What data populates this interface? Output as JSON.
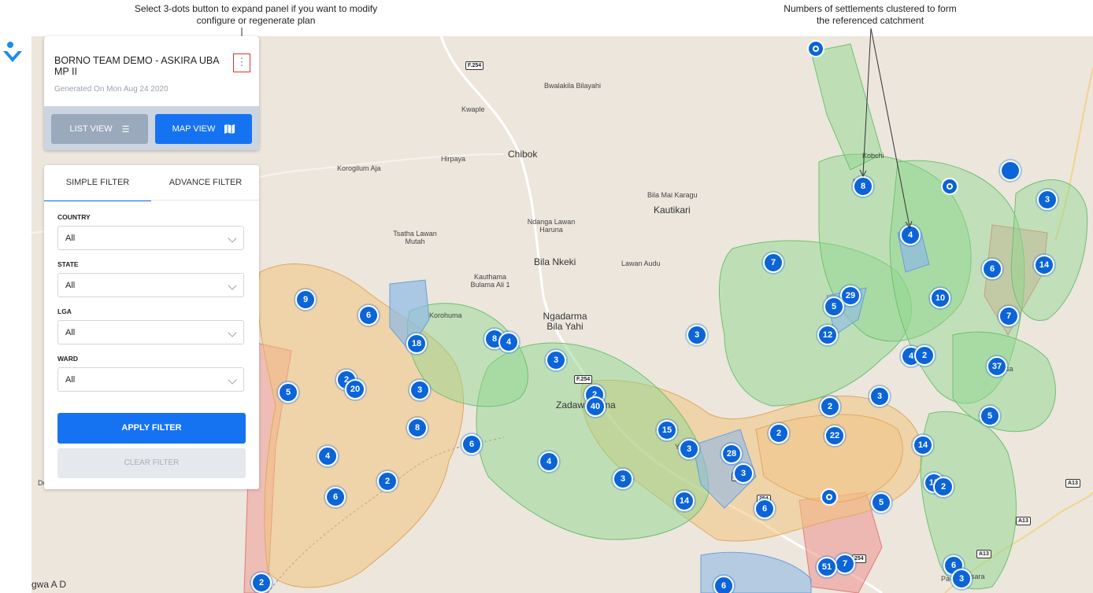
{
  "annotations": {
    "left": "Select 3-dots button to expand panel if you want to modify configure or regenerate plan",
    "right": "Numbers of settlements clustered to form the referenced catchment"
  },
  "plan": {
    "title": "BORNO TEAM DEMO - ASKIRA UBA MP II",
    "generated": "Generated On Mon Aug 24 2020",
    "menu_icon": "vertical-dots-icon",
    "list_view_label": "LIST VIEW",
    "list_view_icon": "list-icon",
    "map_view_label": "MAP VIEW",
    "map_view_icon": "map-icon"
  },
  "filter": {
    "tabs": [
      "SIMPLE FILTER",
      "ADVANCE FILTER"
    ],
    "active_tab": "SIMPLE FILTER",
    "fields": [
      {
        "label": "COUNTRY",
        "value": "All"
      },
      {
        "label": "STATE",
        "value": "All"
      },
      {
        "label": "LGA",
        "value": "All"
      },
      {
        "label": "WARD",
        "value": "All"
      }
    ],
    "apply_label": "APPLY FILTER",
    "clear_label": "CLEAR FILTER"
  },
  "map": {
    "places": [
      "Bwalakila Bilayahi",
      "Kwaple",
      "Chibok",
      "Hirpaya",
      "Korogilum Aja",
      "Kobchi",
      "Bila Mai Karagu",
      "Kautikari",
      "Ndanga Lawan Haruna",
      "Tsatha Lawan Mutah",
      "Bila Nkeki",
      "Lawan Audu",
      "Kauthama Bulama Ali 1",
      "Korohuma",
      "Ngadarma Bila Yahi",
      "Zadawa",
      "ma",
      "gwa A D",
      "De",
      "sa",
      "sara",
      "Pa",
      "Y",
      "Mu",
      "u"
    ],
    "road_labels": [
      "F.254",
      "F.254",
      "F.254",
      "254",
      "254",
      "A13",
      "A13",
      "A13"
    ],
    "clusters": [
      "8",
      "3",
      "4",
      "6",
      "14",
      "7",
      "29",
      "5",
      "10",
      "7",
      "12",
      "4",
      "2",
      "37",
      "3",
      "3",
      "2",
      "5",
      "2",
      "22",
      "14",
      "15",
      "2",
      "5",
      "6",
      "7",
      "51",
      "6",
      "3",
      "9",
      "6",
      "18",
      "8",
      "4",
      "3",
      "2",
      "20",
      "5",
      "3",
      "2",
      "40",
      "8",
      "6",
      "15",
      "3",
      "28",
      "3",
      "4",
      "4",
      "3",
      "6",
      "2",
      "14",
      "6",
      "2"
    ]
  },
  "colors": {
    "primary": "#1573f2",
    "cluster": "#0b64d8",
    "green_zone": "#8fd88f",
    "orange_zone": "#f2c27e",
    "red_zone": "#ee9a96",
    "blue_zone": "#8fb9e6"
  }
}
